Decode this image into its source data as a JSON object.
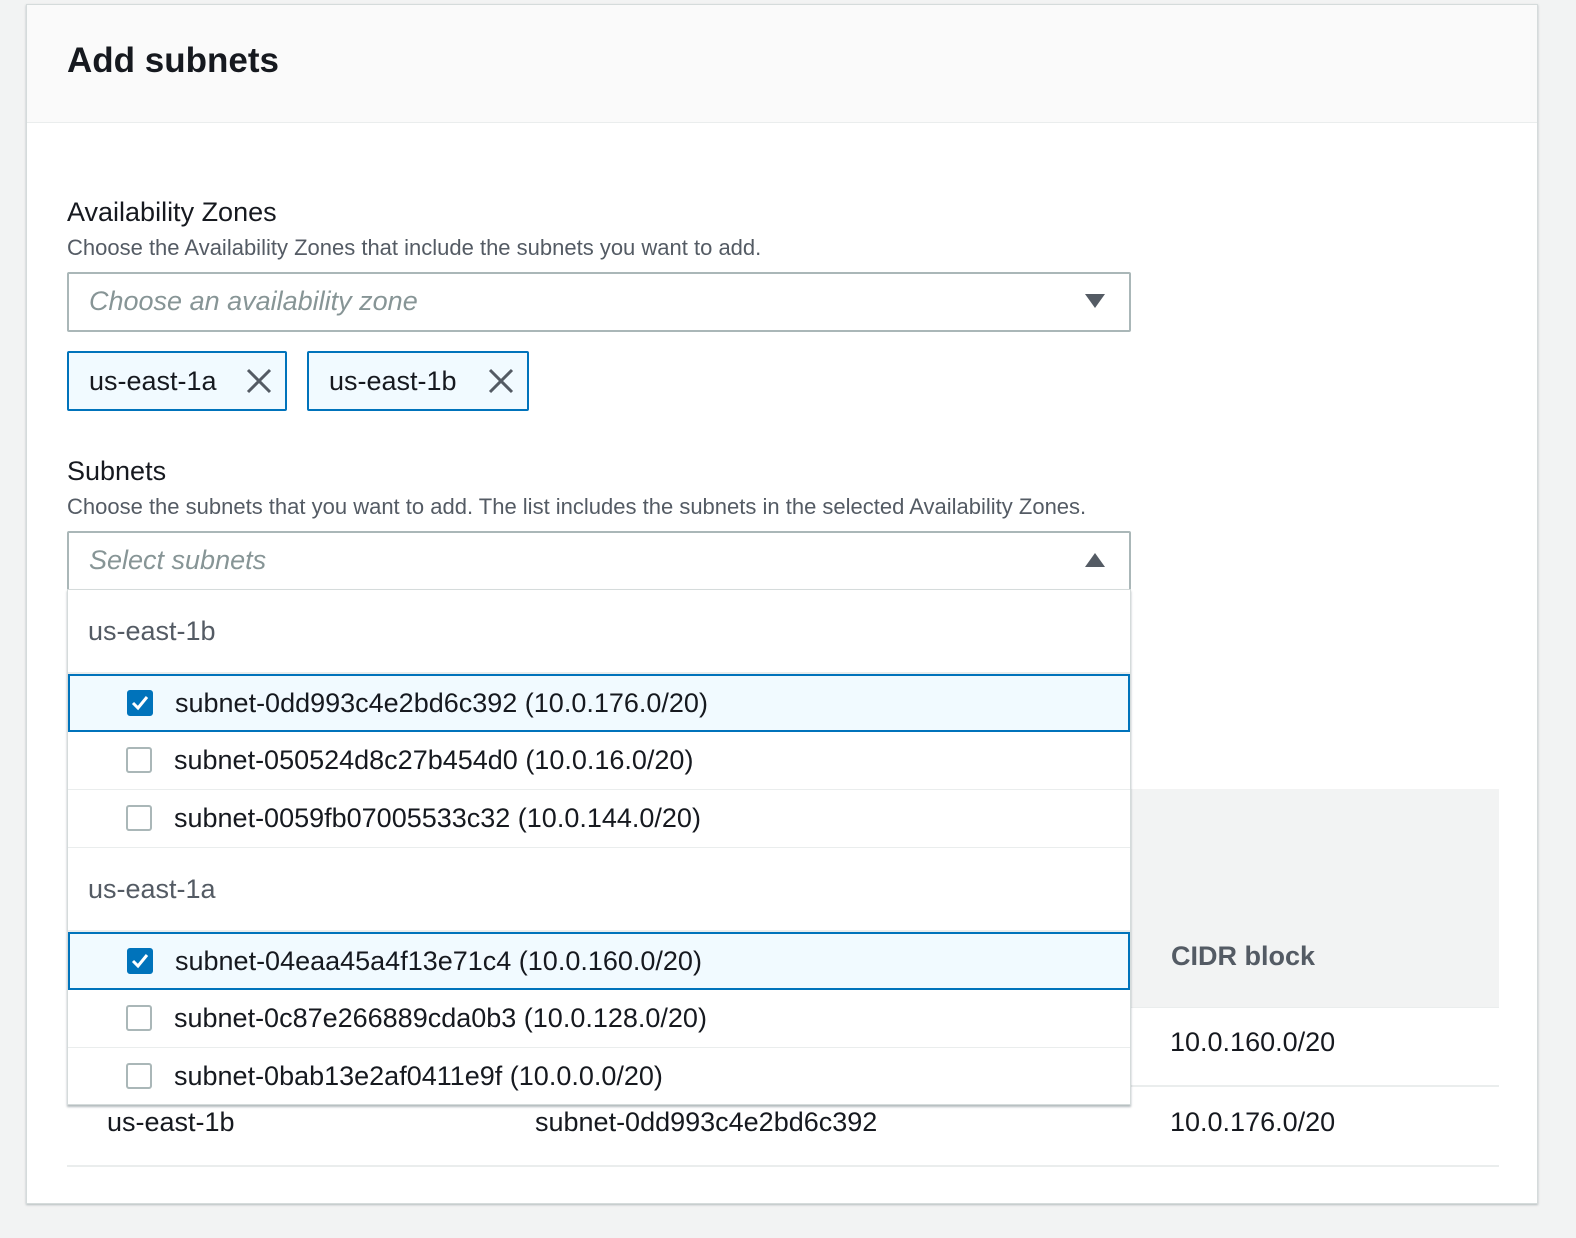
{
  "panel": {
    "title": "Add subnets"
  },
  "availability_zones": {
    "label": "Availability Zones",
    "description": "Choose the Availability Zones that include the subnets you want to add.",
    "placeholder": "Choose an availability zone",
    "tokens": [
      "us-east-1a",
      "us-east-1b"
    ]
  },
  "subnets": {
    "label": "Subnets",
    "description": "Choose the subnets that you want to add. The list includes the subnets in the selected Availability Zones.",
    "placeholder": "Select subnets",
    "dropdown": {
      "groups": [
        {
          "name": "us-east-1b",
          "options": [
            {
              "label": "subnet-0dd993c4e2bd6c392 (10.0.176.0/20)",
              "checked": true
            },
            {
              "label": "subnet-050524d8c27b454d0 (10.0.16.0/20)",
              "checked": false
            },
            {
              "label": "subnet-0059fb07005533c32 (10.0.144.0/20)",
              "checked": false
            }
          ]
        },
        {
          "name": "us-east-1a",
          "options": [
            {
              "label": "subnet-04eaa45a4f13e71c4 (10.0.160.0/20)",
              "checked": true
            },
            {
              "label": "subnet-0c87e266889cda0b3 (10.0.128.0/20)",
              "checked": false
            },
            {
              "label": "subnet-0bab13e2af0411e9f (10.0.0.0/20)",
              "checked": false
            }
          ]
        }
      ]
    }
  },
  "table": {
    "columns": {
      "cidr": "CIDR block"
    },
    "rows": [
      {
        "zone": "",
        "subnet": "",
        "cidr": "10.0.160.0/20"
      },
      {
        "zone": "us-east-1b",
        "subnet": "subnet-0dd993c4e2bd6c392",
        "cidr": "10.0.176.0/20"
      }
    ]
  },
  "colors": {
    "accent": "#0073bb",
    "selected_bg": "#f1faff",
    "border": "#aab7b8"
  }
}
